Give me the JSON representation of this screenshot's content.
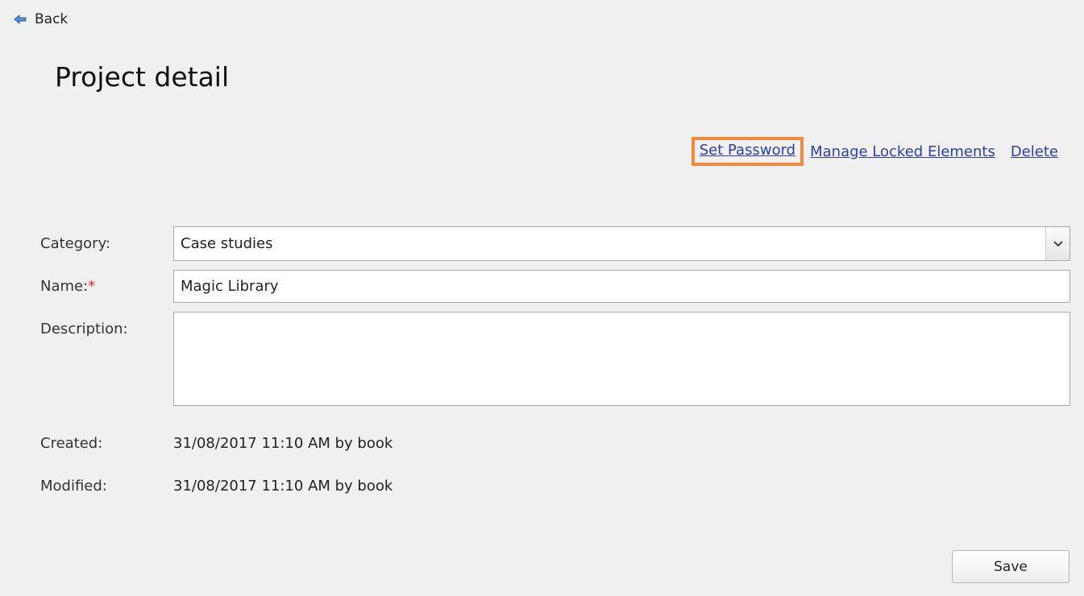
{
  "nav": {
    "back_label": "Back",
    "back_icon": "left-arrow-icon"
  },
  "page": {
    "title": "Project detail"
  },
  "actions": {
    "set_password": "Set Password",
    "manage_locked": "Manage Locked Elements",
    "delete": "Delete",
    "highlight_color": "#f08a3c",
    "link_color": "#2d3fa3"
  },
  "form": {
    "category": {
      "label": "Category:",
      "value": "Case studies"
    },
    "name": {
      "label": "Name:",
      "required_mark": "*",
      "value": "Magic Library"
    },
    "description": {
      "label": "Description:",
      "value": ""
    }
  },
  "meta": {
    "created_label": "Created:",
    "created_value": "31/08/2017 11:10 AM by book",
    "modified_label": "Modified:",
    "modified_value": "31/08/2017 11:10 AM by book"
  },
  "footer": {
    "save_label": "Save"
  }
}
